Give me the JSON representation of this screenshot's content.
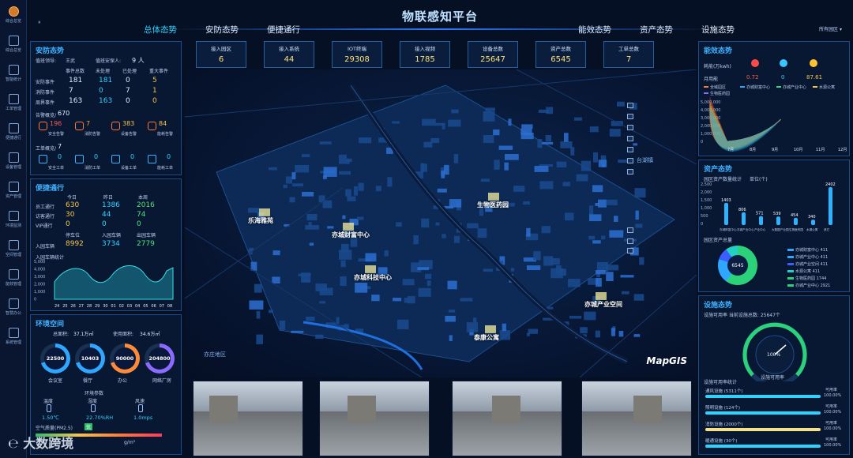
{
  "sidebar": {
    "items": [
      {
        "label": "综合总览",
        "icon": "logo-icon"
      },
      {
        "label": "综合总览",
        "icon": "home-icon"
      },
      {
        "label": "智能统计",
        "icon": "chart-icon"
      },
      {
        "label": "工单管理",
        "icon": "ticket-icon"
      },
      {
        "label": "便捷通行",
        "icon": "car-icon"
      },
      {
        "label": "设备管理",
        "icon": "device-icon"
      },
      {
        "label": "资产管理",
        "icon": "asset-icon"
      },
      {
        "label": "环境监测",
        "icon": "env-icon"
      },
      {
        "label": "空间管理",
        "icon": "space-icon"
      },
      {
        "label": "能效管理",
        "icon": "energy-icon"
      },
      {
        "label": "智慧办公",
        "icon": "office-icon"
      },
      {
        "label": "系统管理",
        "icon": "system-icon"
      }
    ]
  },
  "header": {
    "title": "物联感知平台",
    "nav_left": [
      "总体态势",
      "安防态势",
      "便捷通行"
    ],
    "nav_right": [
      "能效态势",
      "资产态势",
      "设施态势"
    ],
    "selector": "所有园区"
  },
  "kpis": [
    {
      "label": "接入园区",
      "value": "6"
    },
    {
      "label": "接入系统",
      "value": "44"
    },
    {
      "label": "IOT终端",
      "value": "29308"
    },
    {
      "label": "接入视频",
      "value": "1785"
    },
    {
      "label": "设备总数",
      "value": "25647"
    },
    {
      "label": "资产总数",
      "value": "6545"
    },
    {
      "label": "工单总数",
      "value": "7"
    }
  ],
  "security": {
    "title": "安防态势",
    "leader_label": "值班领导:",
    "leader_name": "王武",
    "duty_label": "值班安保人:",
    "duty_value": "9 人",
    "headers": [
      "事件总数",
      "未处理",
      "已处理",
      "重大事件"
    ],
    "rows": [
      {
        "label": "安防事件",
        "values": [
          "181",
          "181",
          "0",
          "5"
        ]
      },
      {
        "label": "消防事件",
        "values": [
          "7",
          "0",
          "7",
          "1"
        ]
      },
      {
        "label": "周界事件",
        "values": [
          "163",
          "163",
          "0",
          "0"
        ]
      }
    ],
    "alarm_label": "告警概览/",
    "alarm_total": "670",
    "alarms": [
      {
        "label": "安全告警",
        "value": "196"
      },
      {
        "label": "消防告警",
        "value": "7"
      },
      {
        "label": "设备告警",
        "value": "383"
      },
      {
        "label": "能耗告警",
        "value": "84"
      }
    ],
    "ticket_label": "工单概览/",
    "ticket_total": "7",
    "tickets": [
      {
        "label": "安全工单",
        "value": "0"
      },
      {
        "label": "消防工单",
        "value": "0"
      },
      {
        "label": "设备工单",
        "value": "0"
      },
      {
        "label": "能耗工单",
        "value": "0"
      }
    ]
  },
  "traffic": {
    "title": "便捷通行",
    "cols": [
      "今日",
      "昨日",
      "本周"
    ],
    "rows": [
      {
        "label": "员工通行",
        "values": [
          "630",
          "1386",
          "2016"
        ]
      },
      {
        "label": "访客通行",
        "values": [
          "30",
          "44",
          "74"
        ]
      },
      {
        "label": "VIP通行",
        "values": [
          "0",
          "0",
          "0"
        ]
      }
    ],
    "car_cols": [
      "停车位",
      "入园车辆",
      "出园车辆"
    ],
    "car_label": "入园车辆",
    "car_values": [
      "8992",
      "3734",
      "2779"
    ],
    "chart_title": "入园车辆统计",
    "yticks": [
      "5,000",
      "4,000",
      "3,000",
      "2,000",
      "1,000",
      "0"
    ],
    "xticks": [
      "24",
      "25",
      "26",
      "27",
      "28",
      "29",
      "30",
      "01",
      "02",
      "03",
      "04",
      "05",
      "06",
      "07",
      "08"
    ]
  },
  "environment": {
    "title": "环境空间",
    "area_label": "总面积:",
    "area_value": "37.1万㎡",
    "used_label": "使用面积:",
    "used_value": "34.6万㎡",
    "donuts": [
      {
        "value": "22500",
        "label": "会议室"
      },
      {
        "value": "10403",
        "label": "餐厅"
      },
      {
        "value": "90000",
        "label": "办公"
      },
      {
        "value": "204800",
        "label": "网络厂房"
      }
    ],
    "env_title": "环境参数",
    "env_cols": [
      "温度",
      "湿度",
      "风速"
    ],
    "env_values": [
      "1.50℃",
      "22.70%RH",
      "1.0mps"
    ],
    "air_label": "空气质量(PM2.5)",
    "air_badge": "优",
    "air_unit": "g/m³"
  },
  "energy": {
    "title": "能效态势",
    "consumption_label": "耗能(万kwh)",
    "month_label": "月用能",
    "values": [
      "0.72",
      "0",
      "87.61"
    ],
    "legend": [
      "全域园区",
      "亦城财富中心",
      "亦城产业中心",
      "水源公寓",
      "生物医药园"
    ],
    "yticks": [
      "5,000,000",
      "4,000,000",
      "3,000,000",
      "2,000,000",
      "1,000,000",
      "0"
    ],
    "xticks": [
      "7月",
      "8月",
      "9月",
      "10月",
      "11月",
      "12月"
    ]
  },
  "assets": {
    "title": "资产态势",
    "chart_title": "园区资产数量统计",
    "unit": "单位(个)",
    "bars": [
      {
        "label": "亦城财富中心",
        "value": 1403
      },
      {
        "label": "亦城产业中心",
        "value": 806
      },
      {
        "label": "产业中心",
        "value": 571
      },
      {
        "label": "大数据产业园",
        "value": 539
      },
      {
        "label": "生物医药园",
        "value": 454
      },
      {
        "label": "水源公寓",
        "value": 340
      },
      {
        "label": "其它",
        "value": 2402
      }
    ],
    "yticks": [
      "2,500",
      "2,000",
      "1,500",
      "1,000",
      "500",
      "0"
    ],
    "pie_title": "园区资产总量",
    "pie_total": "6545",
    "legend": [
      "亦城财富中心 411",
      "亦城产业中心 411",
      "亦城产业空间 411",
      "水源公寓 411",
      "生物医药园 1744",
      "亦城产业中心 2921"
    ]
  },
  "facilities": {
    "title": "设施态势",
    "summary": "设施可用率  当前设施总数: 25647个",
    "gauge_value": "100%",
    "gauge_label": "设施可用率",
    "list_title": "设施可用率统计",
    "items": [
      {
        "label": "通风设施 (5311个)",
        "status": "可用率",
        "pct": "100.00%"
      },
      {
        "label": "照明设施 (124个)",
        "status": "可用率",
        "pct": "100.00%"
      },
      {
        "label": "消防设施 (2000个)",
        "status": "可用率",
        "pct": "100.00%"
      },
      {
        "label": "暖通设施 (30个)",
        "status": "可用率",
        "pct": "100.00%"
      }
    ]
  },
  "map": {
    "labels": [
      "乐海雅苑",
      "亦城财富中心",
      "亦城科技中心",
      "生物医药园",
      "亦城产业空间",
      "泰康公寓"
    ],
    "districts": [
      "台湖镇",
      "亦庄地区"
    ],
    "brand": "MapGIS"
  },
  "watermark": "大数跨境"
}
